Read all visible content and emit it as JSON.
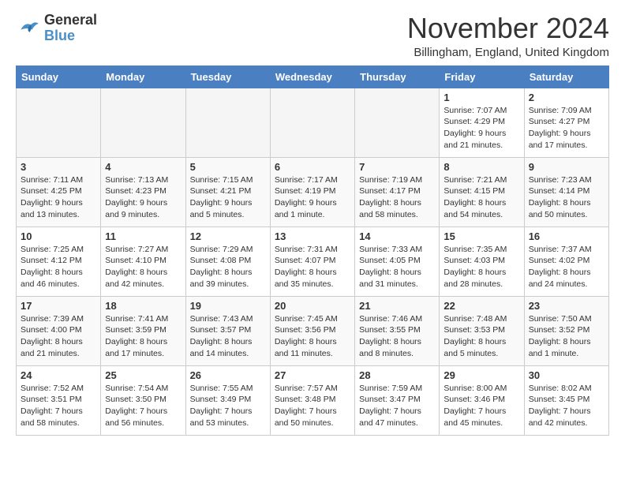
{
  "header": {
    "logo_line1": "General",
    "logo_line2": "Blue",
    "month_title": "November 2024",
    "location": "Billingham, England, United Kingdom"
  },
  "weekdays": [
    "Sunday",
    "Monday",
    "Tuesday",
    "Wednesday",
    "Thursday",
    "Friday",
    "Saturday"
  ],
  "weeks": [
    [
      {
        "day": "",
        "info": ""
      },
      {
        "day": "",
        "info": ""
      },
      {
        "day": "",
        "info": ""
      },
      {
        "day": "",
        "info": ""
      },
      {
        "day": "",
        "info": ""
      },
      {
        "day": "1",
        "info": "Sunrise: 7:07 AM\nSunset: 4:29 PM\nDaylight: 9 hours and 21 minutes."
      },
      {
        "day": "2",
        "info": "Sunrise: 7:09 AM\nSunset: 4:27 PM\nDaylight: 9 hours and 17 minutes."
      }
    ],
    [
      {
        "day": "3",
        "info": "Sunrise: 7:11 AM\nSunset: 4:25 PM\nDaylight: 9 hours and 13 minutes."
      },
      {
        "day": "4",
        "info": "Sunrise: 7:13 AM\nSunset: 4:23 PM\nDaylight: 9 hours and 9 minutes."
      },
      {
        "day": "5",
        "info": "Sunrise: 7:15 AM\nSunset: 4:21 PM\nDaylight: 9 hours and 5 minutes."
      },
      {
        "day": "6",
        "info": "Sunrise: 7:17 AM\nSunset: 4:19 PM\nDaylight: 9 hours and 1 minute."
      },
      {
        "day": "7",
        "info": "Sunrise: 7:19 AM\nSunset: 4:17 PM\nDaylight: 8 hours and 58 minutes."
      },
      {
        "day": "8",
        "info": "Sunrise: 7:21 AM\nSunset: 4:15 PM\nDaylight: 8 hours and 54 minutes."
      },
      {
        "day": "9",
        "info": "Sunrise: 7:23 AM\nSunset: 4:14 PM\nDaylight: 8 hours and 50 minutes."
      }
    ],
    [
      {
        "day": "10",
        "info": "Sunrise: 7:25 AM\nSunset: 4:12 PM\nDaylight: 8 hours and 46 minutes."
      },
      {
        "day": "11",
        "info": "Sunrise: 7:27 AM\nSunset: 4:10 PM\nDaylight: 8 hours and 42 minutes."
      },
      {
        "day": "12",
        "info": "Sunrise: 7:29 AM\nSunset: 4:08 PM\nDaylight: 8 hours and 39 minutes."
      },
      {
        "day": "13",
        "info": "Sunrise: 7:31 AM\nSunset: 4:07 PM\nDaylight: 8 hours and 35 minutes."
      },
      {
        "day": "14",
        "info": "Sunrise: 7:33 AM\nSunset: 4:05 PM\nDaylight: 8 hours and 31 minutes."
      },
      {
        "day": "15",
        "info": "Sunrise: 7:35 AM\nSunset: 4:03 PM\nDaylight: 8 hours and 28 minutes."
      },
      {
        "day": "16",
        "info": "Sunrise: 7:37 AM\nSunset: 4:02 PM\nDaylight: 8 hours and 24 minutes."
      }
    ],
    [
      {
        "day": "17",
        "info": "Sunrise: 7:39 AM\nSunset: 4:00 PM\nDaylight: 8 hours and 21 minutes."
      },
      {
        "day": "18",
        "info": "Sunrise: 7:41 AM\nSunset: 3:59 PM\nDaylight: 8 hours and 17 minutes."
      },
      {
        "day": "19",
        "info": "Sunrise: 7:43 AM\nSunset: 3:57 PM\nDaylight: 8 hours and 14 minutes."
      },
      {
        "day": "20",
        "info": "Sunrise: 7:45 AM\nSunset: 3:56 PM\nDaylight: 8 hours and 11 minutes."
      },
      {
        "day": "21",
        "info": "Sunrise: 7:46 AM\nSunset: 3:55 PM\nDaylight: 8 hours and 8 minutes."
      },
      {
        "day": "22",
        "info": "Sunrise: 7:48 AM\nSunset: 3:53 PM\nDaylight: 8 hours and 5 minutes."
      },
      {
        "day": "23",
        "info": "Sunrise: 7:50 AM\nSunset: 3:52 PM\nDaylight: 8 hours and 1 minute."
      }
    ],
    [
      {
        "day": "24",
        "info": "Sunrise: 7:52 AM\nSunset: 3:51 PM\nDaylight: 7 hours and 58 minutes."
      },
      {
        "day": "25",
        "info": "Sunrise: 7:54 AM\nSunset: 3:50 PM\nDaylight: 7 hours and 56 minutes."
      },
      {
        "day": "26",
        "info": "Sunrise: 7:55 AM\nSunset: 3:49 PM\nDaylight: 7 hours and 53 minutes."
      },
      {
        "day": "27",
        "info": "Sunrise: 7:57 AM\nSunset: 3:48 PM\nDaylight: 7 hours and 50 minutes."
      },
      {
        "day": "28",
        "info": "Sunrise: 7:59 AM\nSunset: 3:47 PM\nDaylight: 7 hours and 47 minutes."
      },
      {
        "day": "29",
        "info": "Sunrise: 8:00 AM\nSunset: 3:46 PM\nDaylight: 7 hours and 45 minutes."
      },
      {
        "day": "30",
        "info": "Sunrise: 8:02 AM\nSunset: 3:45 PM\nDaylight: 7 hours and 42 minutes."
      }
    ]
  ]
}
